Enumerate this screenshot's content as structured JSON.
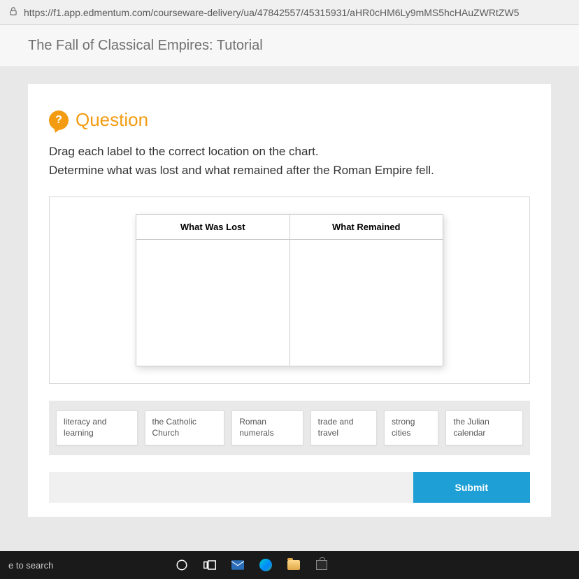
{
  "browser": {
    "url": "https://f1.app.edmentum.com/courseware-delivery/ua/47842557/45315931/aHR0cHM6Ly9mMS5hcHAuZWRtZW5"
  },
  "header": {
    "title": "The Fall of Classical Empires: Tutorial"
  },
  "question": {
    "icon_label": "?",
    "title": "Question",
    "instruction_line1": "Drag each label to the correct location on the chart.",
    "instruction_line2": "Determine what was lost and what remained after the Roman Empire fell."
  },
  "chart": {
    "col1": "What Was Lost",
    "col2": "What Remained"
  },
  "labels": {
    "l1": "literacy and learning",
    "l2": "the Catholic Church",
    "l3": "Roman numerals",
    "l4": "trade and travel",
    "l5": "strong cities",
    "l6": "the Julian calendar"
  },
  "actions": {
    "submit": "Submit"
  },
  "taskbar": {
    "search": "e to search"
  }
}
